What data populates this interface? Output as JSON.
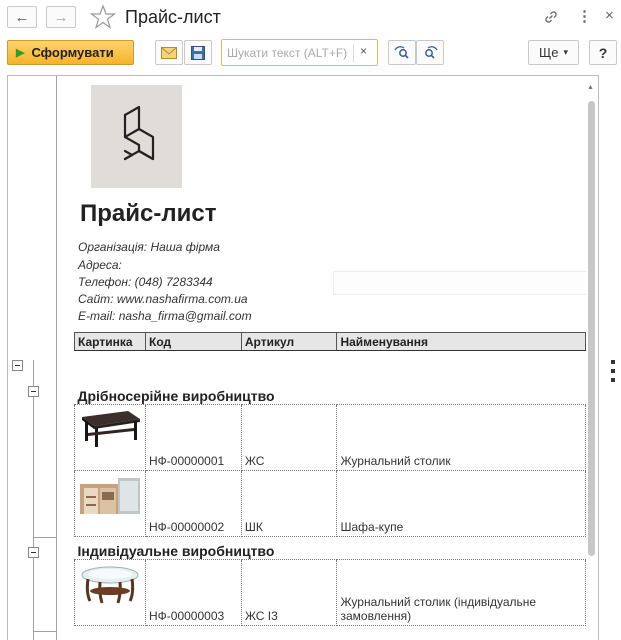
{
  "window": {
    "title": "Прайс-лист",
    "back_icon": "←",
    "forward_icon": "→",
    "link_icon": "🔗",
    "menu_icon": "⋮",
    "close_icon": "×"
  },
  "toolbar": {
    "generate_label": "Сформувати",
    "search": {
      "placeholder": "Шукати текст (ALT+F)",
      "clear_icon": "×"
    },
    "more_label": "Ще",
    "more_caret": "▾",
    "help_label": "?"
  },
  "report": {
    "title": "Прайс-лист",
    "info": [
      {
        "label": "Організація",
        "value": "Наша фірма"
      },
      {
        "label": "Адреса",
        "value": ""
      },
      {
        "label": "Телефон",
        "value": "(048) 7283344"
      },
      {
        "label": "Сайт",
        "value": "www.nashafirma.com.ua"
      },
      {
        "label": "E-mail",
        "value": "nasha_firma@gmail.com"
      }
    ],
    "columns": [
      "Картинка",
      "Код",
      "Артикул",
      "Найменування"
    ],
    "groups": [
      {
        "name": "Дрібносерійне виробництво",
        "items": [
          {
            "image": "coffee-table-image",
            "code": "НФ-00000001",
            "sku": "ЖС",
            "name": "Журнальний столик"
          },
          {
            "image": "wardrobe-image",
            "code": "НФ-00000002",
            "sku": "ШК",
            "name": "Шафа-купе"
          }
        ]
      },
      {
        "name": "Індивідуальне виробництво",
        "items": [
          {
            "image": "glass-table-image",
            "code": "НФ-00000003",
            "sku": "ЖС І3",
            "name": "Журнальний столик (індивідуальне замовлення)"
          }
        ]
      }
    ]
  },
  "colors": {
    "accent": "#f5b32b",
    "search_border": "#f0b656",
    "header_bg": "#e6e6e6"
  }
}
